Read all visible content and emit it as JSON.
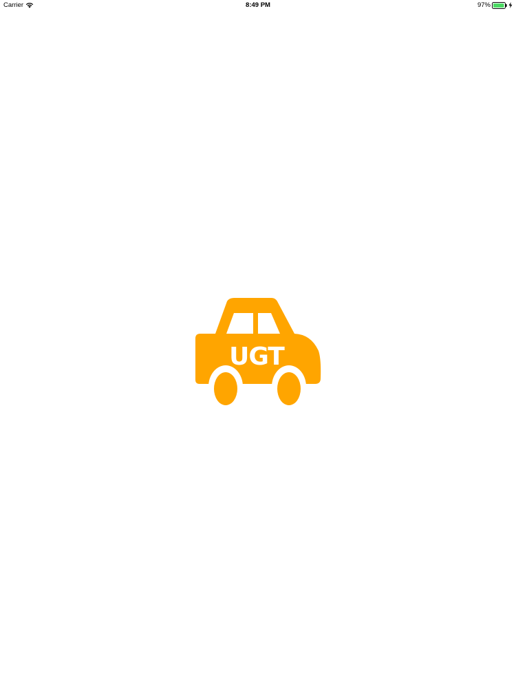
{
  "status_bar": {
    "carrier": "Carrier",
    "time": "8:49 PM",
    "battery_percent_label": "97%",
    "battery_level": 0.97
  },
  "splash": {
    "logo_text": "UGT",
    "logo_icon": "car-icon",
    "brand_color": "#FFA500",
    "background_color": "#FFFFFF"
  }
}
